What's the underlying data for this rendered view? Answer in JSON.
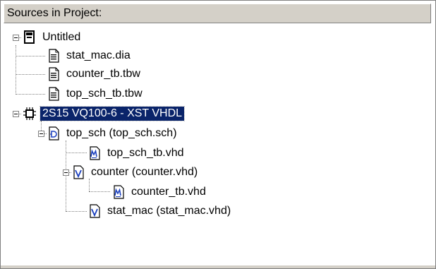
{
  "panel": {
    "title": "Sources in Project:"
  },
  "tree": [
    {
      "label": "Untitled",
      "icon": "project-icon"
    },
    {
      "label": "stat_mac.dia",
      "icon": "document-icon"
    },
    {
      "label": "counter_tb.tbw",
      "icon": "document-icon"
    },
    {
      "label": "top_sch_tb.tbw",
      "icon": "document-icon"
    },
    {
      "label": "2S15 VQ100-6 - XST VHDL",
      "icon": "chip-icon",
      "selected": true
    },
    {
      "label": "top_sch (top_sch.sch)",
      "icon": "schematic-icon"
    },
    {
      "label": "top_sch_tb.vhd",
      "icon": "testbench-vhdl-icon"
    },
    {
      "label": "counter (counter.vhd)",
      "icon": "vhdl-module-icon"
    },
    {
      "label": "counter_tb.vhd",
      "icon": "testbench-vhdl-icon"
    },
    {
      "label": "stat_mac (stat_mac.vhd)",
      "icon": "vhdl-module-icon"
    }
  ],
  "colors": {
    "selection_bg": "#0a246a",
    "header_bg": "#d4d0c8"
  }
}
